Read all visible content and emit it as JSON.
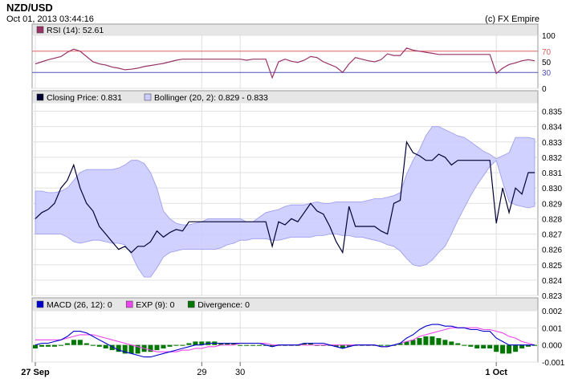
{
  "header": {
    "symbol": "NZD/USD",
    "datetime": "Oct 01, 2013 03:44:16",
    "copyright": "(c) FX Empire"
  },
  "colors": {
    "panel_bg": "#ffffff",
    "legend_bg": "#e6e6e6",
    "grid": "#e0e0e0",
    "rsi_line": "#993366",
    "rsi_high": "#e06060",
    "rsi_low": "#5050c0",
    "price_line": "#000033",
    "band_fill": "#ccccff",
    "band_stroke": "#9999ee",
    "macd_line": "#0000cc",
    "exp_line": "#ee44ee",
    "div_bar": "#007700"
  },
  "chart_data": [
    {
      "type": "line",
      "name": "rsi_panel",
      "legend": [
        {
          "label": "RSI (14): 52.61",
          "color": "#993366"
        }
      ],
      "ylim": [
        0,
        100
      ],
      "yticks": [
        "100",
        "50",
        "0"
      ],
      "levels": [
        {
          "value": 70,
          "label": "70",
          "color": "#e06060"
        },
        {
          "value": 30,
          "label": "30",
          "color": "#5050c0"
        }
      ],
      "series": [
        {
          "values": [
            46,
            50,
            54,
            57,
            60,
            68,
            74,
            70,
            60,
            50,
            46,
            44,
            40,
            38,
            35,
            36,
            38,
            41,
            43,
            45,
            47,
            50,
            53,
            55,
            55,
            55,
            55,
            55,
            55,
            55,
            55,
            55,
            55,
            53,
            55,
            55,
            55,
            20,
            50,
            55,
            51,
            49,
            53,
            60,
            58,
            50,
            45,
            40,
            30,
            46,
            58,
            55,
            52,
            50,
            54,
            65,
            62,
            62,
            76,
            72,
            70,
            68,
            66,
            64,
            64,
            64,
            64,
            64,
            64,
            64,
            64,
            64,
            28,
            38,
            45,
            48,
            52,
            54,
            52
          ]
        }
      ]
    },
    {
      "type": "line",
      "name": "price_panel",
      "legend": [
        {
          "label": "Closing Price: 0.831",
          "color": "#000033"
        },
        {
          "label": "Bollinger (20, 2): 0.829 - 0.833",
          "color": "#ccccff"
        }
      ],
      "ylim": [
        0.823,
        0.8355
      ],
      "yticks": [
        "0.835",
        "0.834",
        "0.833",
        "0.832",
        "0.831",
        "0.830",
        "0.829",
        "0.828",
        "0.827",
        "0.826",
        "0.825",
        "0.824",
        "0.823"
      ],
      "series": [
        {
          "name": "close",
          "values": [
            0.828,
            0.8284,
            0.8286,
            0.829,
            0.83,
            0.8305,
            0.8315,
            0.83,
            0.829,
            0.8285,
            0.8275,
            0.827,
            0.8265,
            0.826,
            0.8262,
            0.8258,
            0.8262,
            0.8262,
            0.8265,
            0.8272,
            0.8268,
            0.8271,
            0.8273,
            0.8272,
            0.8278,
            0.8278,
            0.8278,
            0.8278,
            0.8278,
            0.8278,
            0.8278,
            0.8278,
            0.8278,
            0.8278,
            0.8278,
            0.8278,
            0.8278,
            0.8262,
            0.8278,
            0.8276,
            0.828,
            0.8278,
            0.8284,
            0.829,
            0.8285,
            0.8283,
            0.8275,
            0.8265,
            0.8258,
            0.8288,
            0.8275,
            0.8275,
            0.8275,
            0.8275,
            0.8272,
            0.827,
            0.829,
            0.8292,
            0.833,
            0.8323,
            0.8321,
            0.8318,
            0.8318,
            0.8322,
            0.832,
            0.8315,
            0.8318,
            0.8318,
            0.8318,
            0.8318,
            0.8318,
            0.8318,
            0.8277,
            0.83,
            0.8284,
            0.83,
            0.8296,
            0.831,
            0.831
          ]
        },
        {
          "name": "upper",
          "values": [
            0.8298,
            0.8298,
            0.8297,
            0.8297,
            0.8298,
            0.83,
            0.8305,
            0.831,
            0.8312,
            0.8312,
            0.8312,
            0.8312,
            0.8312,
            0.8313,
            0.8315,
            0.8318,
            0.8318,
            0.8316,
            0.831,
            0.83,
            0.8285,
            0.828,
            0.8277,
            0.8276,
            0.8276,
            0.8277,
            0.8278,
            0.828,
            0.828,
            0.828,
            0.828,
            0.828,
            0.828,
            0.8278,
            0.8278,
            0.8281,
            0.8284,
            0.8285,
            0.8286,
            0.8288,
            0.8289,
            0.8289,
            0.8289,
            0.829,
            0.8291,
            0.829,
            0.829,
            0.8291,
            0.8291,
            0.8291,
            0.8291,
            0.8291,
            0.8292,
            0.8293,
            0.8293,
            0.8294,
            0.8295,
            0.8297,
            0.8309,
            0.8318,
            0.8325,
            0.8334,
            0.834,
            0.834,
            0.8338,
            0.8336,
            0.8334,
            0.8333,
            0.833,
            0.8327,
            0.8324,
            0.8322,
            0.8319,
            0.8321,
            0.8323,
            0.8333,
            0.8333,
            0.8333,
            0.8332
          ]
        },
        {
          "name": "lower",
          "values": [
            0.827,
            0.827,
            0.827,
            0.827,
            0.827,
            0.8268,
            0.8265,
            0.8264,
            0.8265,
            0.8266,
            0.8266,
            0.8265,
            0.8264,
            0.8264,
            0.8263,
            0.8257,
            0.8248,
            0.8242,
            0.8242,
            0.8248,
            0.8255,
            0.8258,
            0.8259,
            0.826,
            0.826,
            0.826,
            0.826,
            0.826,
            0.826,
            0.8261,
            0.8263,
            0.8264,
            0.8266,
            0.8266,
            0.8267,
            0.8267,
            0.8267,
            0.8266,
            0.8266,
            0.8267,
            0.8268,
            0.8268,
            0.8268,
            0.8268,
            0.8269,
            0.8269,
            0.827,
            0.827,
            0.8269,
            0.8269,
            0.8268,
            0.8268,
            0.8267,
            0.8266,
            0.8265,
            0.8263,
            0.8262,
            0.8259,
            0.8254,
            0.825,
            0.8249,
            0.825,
            0.8253,
            0.8258,
            0.8262,
            0.827,
            0.8279,
            0.8287,
            0.8295,
            0.8302,
            0.8308,
            0.8314,
            0.8318,
            0.8304,
            0.8291,
            0.8289,
            0.8288,
            0.8287,
            0.8288
          ]
        }
      ]
    },
    {
      "type": "line",
      "name": "macd_panel",
      "legend": [
        {
          "label": "MACD (26, 12): 0",
          "color": "#0000cc"
        },
        {
          "label": "EXP (9): 0",
          "color": "#ee44ee"
        },
        {
          "label": "Divergence: 0",
          "color": "#007700"
        }
      ],
      "ylim": [
        -0.001,
        0.002
      ],
      "yticks": [
        "0.002",
        "0.001",
        "0.000",
        "-0.001"
      ],
      "series": [
        {
          "name": "macd",
          "values": [
            0.0,
            0.0001,
            0.0001,
            0.0002,
            0.0003,
            0.0005,
            0.0008,
            0.0008,
            0.0007,
            0.0005,
            0.0003,
            0.0001,
            -0.0001,
            -0.0003,
            -0.0004,
            -0.0005,
            -0.0006,
            -0.0007,
            -0.0007,
            -0.0006,
            -0.0005,
            -0.0004,
            -0.0003,
            -0.0002,
            -0.0001,
            0.0,
            0.0,
            0.0001,
            0.0001,
            0.0001,
            0.0001,
            0.0001,
            0.0001,
            0.0001,
            0.0001,
            0.0001,
            0.0,
            -0.0001,
            0.0,
            0.0,
            0.0,
            0.0,
            0.0001,
            0.0001,
            0.0001,
            0.0001,
            0.0,
            -0.0001,
            -0.0002,
            -0.0001,
            0.0,
            0.0,
            0.0,
            0.0,
            -0.0001,
            -0.0001,
            0.0,
            0.0001,
            0.0004,
            0.0006,
            0.0009,
            0.0011,
            0.0012,
            0.0012,
            0.0011,
            0.0011,
            0.001,
            0.001,
            0.0009,
            0.0009,
            0.0008,
            0.0008,
            0.0004,
            0.0002,
            0.0,
            0.0,
            0.0,
            0.0,
            0.0
          ]
        },
        {
          "name": "exp",
          "values": [
            0.0003,
            0.0003,
            0.0003,
            0.0003,
            0.0003,
            0.0004,
            0.0005,
            0.0006,
            0.0006,
            0.0006,
            0.0005,
            0.0004,
            0.0003,
            0.0002,
            0.0001,
            0.0,
            -0.0001,
            -0.0002,
            -0.0003,
            -0.0004,
            -0.0004,
            -0.0004,
            -0.0004,
            -0.0003,
            -0.0003,
            -0.0002,
            -0.0002,
            -0.0001,
            -0.0001,
            0.0,
            0.0,
            0.0,
            0.0001,
            0.0001,
            0.0001,
            0.0001,
            0.0001,
            0.0,
            0.0,
            0.0,
            0.0,
            0.0,
            0.0,
            0.0,
            0.0,
            0.0,
            0.0,
            0.0,
            0.0,
            0.0,
            0.0,
            0.0,
            0.0,
            0.0,
            -0.0001,
            -0.0001,
            0.0,
            0.0001,
            0.0002,
            0.0003,
            0.0005,
            0.0006,
            0.0007,
            0.0008,
            0.0009,
            0.001,
            0.001,
            0.001,
            0.001,
            0.001,
            0.0009,
            0.0009,
            0.0008,
            0.0007,
            0.0005,
            0.0004,
            0.0002,
            0.0001,
            0.0
          ]
        },
        {
          "name": "divergence",
          "values": [
            -0.0002,
            -0.0001,
            -0.0001,
            -0.0001,
            0.0,
            0.0001,
            0.0003,
            0.0003,
            0.0001,
            0.0,
            -0.0001,
            -0.0002,
            -0.0003,
            -0.0004,
            -0.0005,
            -0.0005,
            -0.0005,
            -0.0004,
            -0.0004,
            -0.0003,
            -0.0002,
            -0.0001,
            0.0,
            0.0,
            0.0001,
            0.0002,
            0.0002,
            0.0002,
            0.0002,
            0.0001,
            0.0001,
            0.0001,
            0.0,
            0.0,
            0.0,
            0.0,
            0.0,
            -0.0001,
            0.0,
            0.0,
            0.0,
            0.0,
            0.0001,
            0.0001,
            0.0,
            0.0,
            0.0,
            -0.0001,
            -0.0002,
            -0.0001,
            0.0,
            0.0,
            0.0,
            0.0,
            0.0,
            0.0,
            0.0,
            0.0001,
            0.0002,
            0.0003,
            0.0004,
            0.0005,
            0.0005,
            0.0004,
            0.0003,
            0.0002,
            0.0001,
            0.0,
            -0.0001,
            -0.0002,
            -0.0002,
            -0.0002,
            -0.0004,
            -0.0005,
            -0.0005,
            -0.0004,
            -0.0002,
            -0.0001,
            0.0
          ]
        }
      ]
    }
  ],
  "x_axis": {
    "labels": [
      {
        "index": 0,
        "text": "27 Sep",
        "bold": true
      },
      {
        "index": 26,
        "text": "29",
        "bold": false
      },
      {
        "index": 32,
        "text": "30",
        "bold": false
      },
      {
        "index": 72,
        "text": "1 Oct",
        "bold": true
      }
    ]
  }
}
